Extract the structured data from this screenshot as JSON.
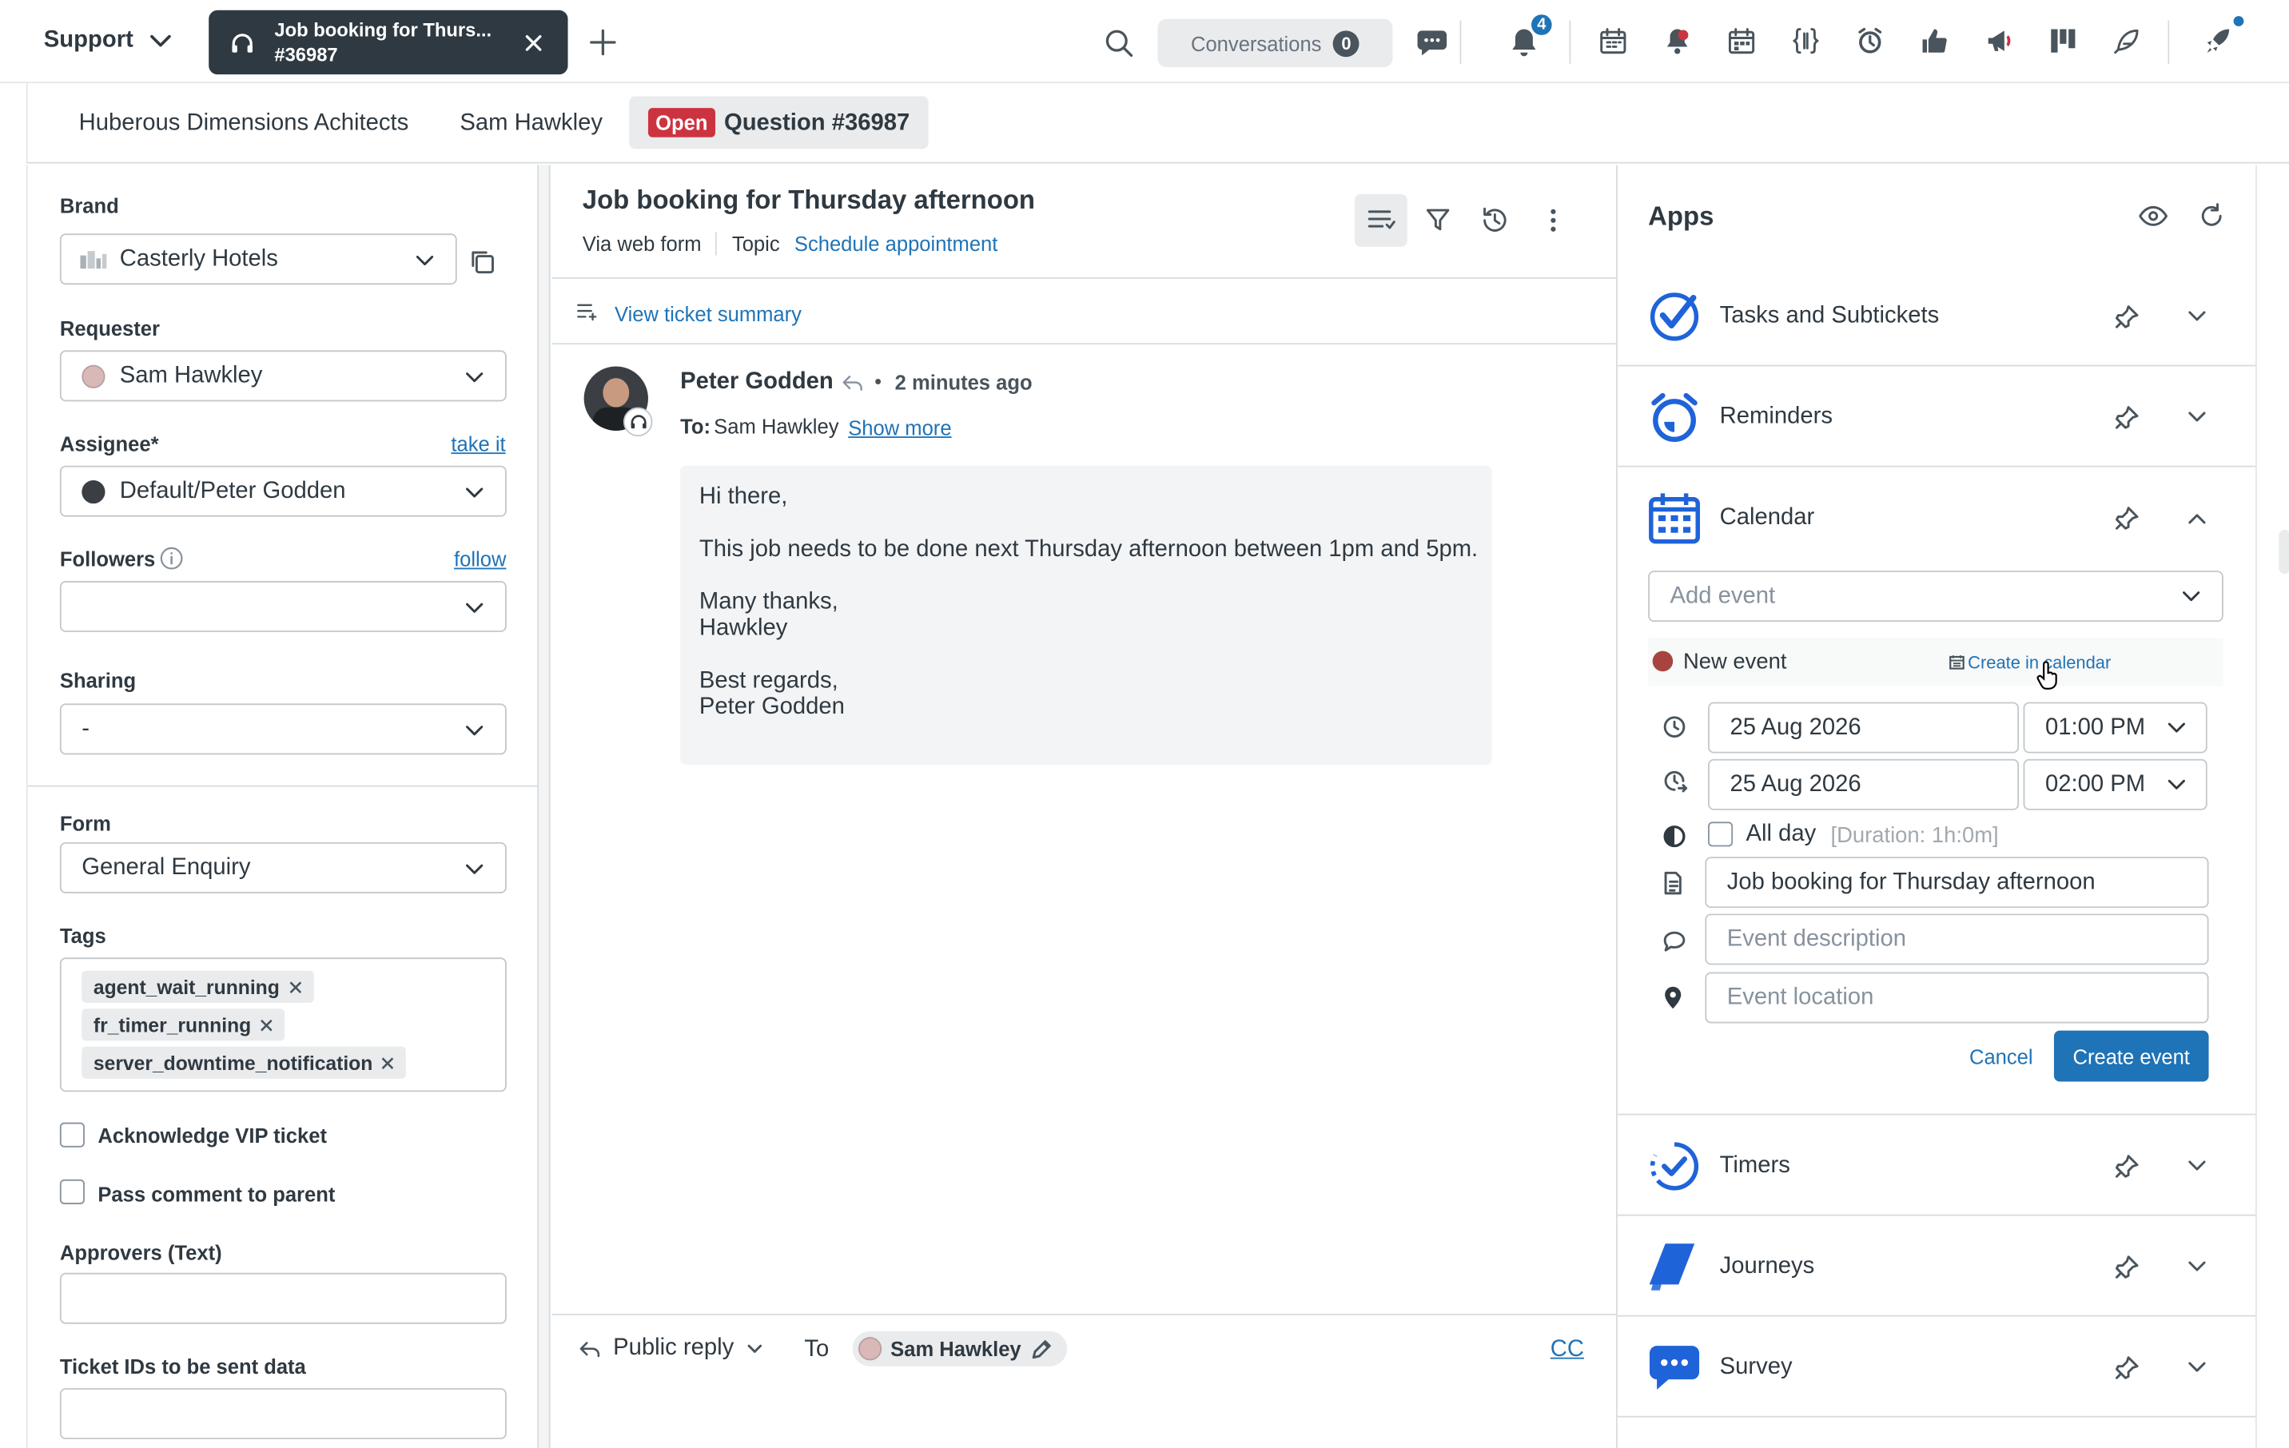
{
  "topbar": {
    "workspace": "Support",
    "active_tab": {
      "title": "Job booking for Thurs...",
      "ticket": "#36987"
    },
    "conversations_label": "Conversations",
    "conversations_count": "0",
    "notifications_count": "4"
  },
  "breadcrumbs": {
    "org": "Huberous Dimensions Achitects",
    "user": "Sam Hawkley",
    "status": "Open",
    "ticket": "Question #36987"
  },
  "fields": {
    "brand_label": "Brand",
    "brand_value": "Casterly Hotels",
    "requester_label": "Requester",
    "requester_value": "Sam Hawkley",
    "assignee_label": "Assignee*",
    "assignee_link": "take it",
    "assignee_value": "Default/Peter Godden",
    "followers_label": "Followers",
    "followers_link": "follow",
    "followers_value": "",
    "sharing_label": "Sharing",
    "sharing_value": "-",
    "form_label": "Form",
    "form_value": "General Enquiry",
    "tags_label": "Tags",
    "tags": [
      "agent_wait_running",
      "fr_timer_running",
      "server_downtime_notification"
    ],
    "vip_label": "Acknowledge VIP ticket",
    "pass_label": "Pass comment to parent",
    "approvers_label": "Approvers (Text)",
    "ticketids_label": "Ticket IDs to be sent data"
  },
  "ticket": {
    "title": "Job booking for Thursday afternoon",
    "via": "Via web form",
    "topic_label": "Topic",
    "topic_value": "Schedule appointment",
    "summary_link": "View ticket summary",
    "author": "Peter Godden",
    "time": "2 minutes ago",
    "to_label": "To:",
    "to_value": "Sam Hawkley",
    "show_more": "Show more",
    "body": {
      "l1": "Hi there,",
      "l2": "This job needs to be done next Thursday afternoon between 1pm and 5pm.",
      "l3": "Many thanks,",
      "l4": "Hawkley",
      "l5": "Best regards,",
      "l6": "Peter Godden"
    },
    "reply_mode": "Public reply",
    "reply_to_label": "To",
    "reply_to": "Sam Hawkley",
    "cc": "CC"
  },
  "apps": {
    "title": "Apps",
    "items": [
      {
        "name": "Tasks and Subtickets"
      },
      {
        "name": "Reminders"
      },
      {
        "name": "Calendar"
      },
      {
        "name": "Timers"
      },
      {
        "name": "Journeys"
      },
      {
        "name": "Survey"
      }
    ],
    "calendar": {
      "add_event_placeholder": "Add event",
      "new_event": "New event",
      "create_in_calendar": "Create in calendar",
      "start_date": "25 Aug 2026",
      "start_time": "01:00 PM",
      "end_date": "25 Aug 2026",
      "end_time": "02:00 PM",
      "all_day": "All day",
      "duration": "[Duration: 1h:0m]",
      "event_title": "Job booking for Thursday afternoon",
      "description_placeholder": "Event description",
      "location_placeholder": "Event location",
      "cancel": "Cancel",
      "create": "Create event",
      "event_color": "#a8443f"
    }
  },
  "colors": {
    "accent": "#1f73b7",
    "open_badge": "#cc3340",
    "app_icon": "#1f63d9"
  }
}
